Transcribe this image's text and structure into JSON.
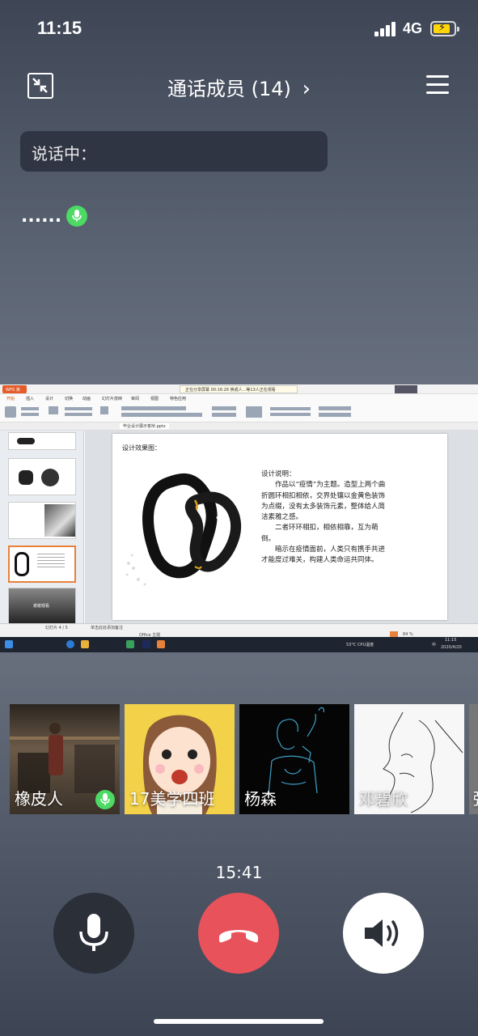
{
  "status_bar": {
    "time": "11:15",
    "network": "4G",
    "battery_level": 0.65
  },
  "header": {
    "title": "通话成员 (14)",
    "chevron": "›",
    "minimize_icon": "minimize-icon",
    "menu_icon": "menu-icon"
  },
  "speaking": {
    "label": "说话中：",
    "speaker": "......"
  },
  "screen_share": {
    "app_name": "WPS 演示",
    "notice": "正在分享屏幕    00:16:26    换成人...等13人正在观看",
    "ribbon_tabs": [
      "开始",
      "插入",
      "设计",
      "切换",
      "动画",
      "幻灯片放映",
      "审阅",
      "视图",
      "特色应用"
    ],
    "doc_tab": "毕业设计展示答辩.pptx",
    "slide_heading": "设计效果图：",
    "slide_text": [
      "设计说明：",
      "　　作品以“疫情”为主题。造型上两个曲折圆环相扣相依，交界处镶以金黄色装饰为点缀，没有太多装饰元素，整体给人简洁素雅之感。",
      "　　二者环环相扣，相依相靠，互为萌倒。",
      "　　暗示在疫情面前，人类只有携手共进才能度过难关，构建人类命运共同体。"
    ],
    "thumb_caption": "谢谢观看",
    "status_left": "幻灯片 4 / 5",
    "status_note": "单击此处添加备注",
    "status_center": "Office 主题",
    "zoom": "84 %",
    "taskbar_weather": "53°C CPU温度",
    "taskbar_time": "11:15",
    "taskbar_date": "2020/4/20",
    "taskbar_lang": "中"
  },
  "participants": [
    {
      "name": "橡皮人",
      "mic_active": true
    },
    {
      "name": "17美学四班",
      "mic_active": false
    },
    {
      "name": "杨森",
      "mic_active": false
    },
    {
      "name": "邓碧欣",
      "mic_active": false
    },
    {
      "name": "张",
      "mic_active": false
    }
  ],
  "call": {
    "duration": "15:41"
  },
  "controls": {
    "mute": "microphone-icon",
    "hangup": "hangup-icon",
    "speaker": "speaker-icon"
  },
  "colors": {
    "green": "#4cd964",
    "hangup": "#e8525a",
    "control_dark": "#2a2f38"
  }
}
